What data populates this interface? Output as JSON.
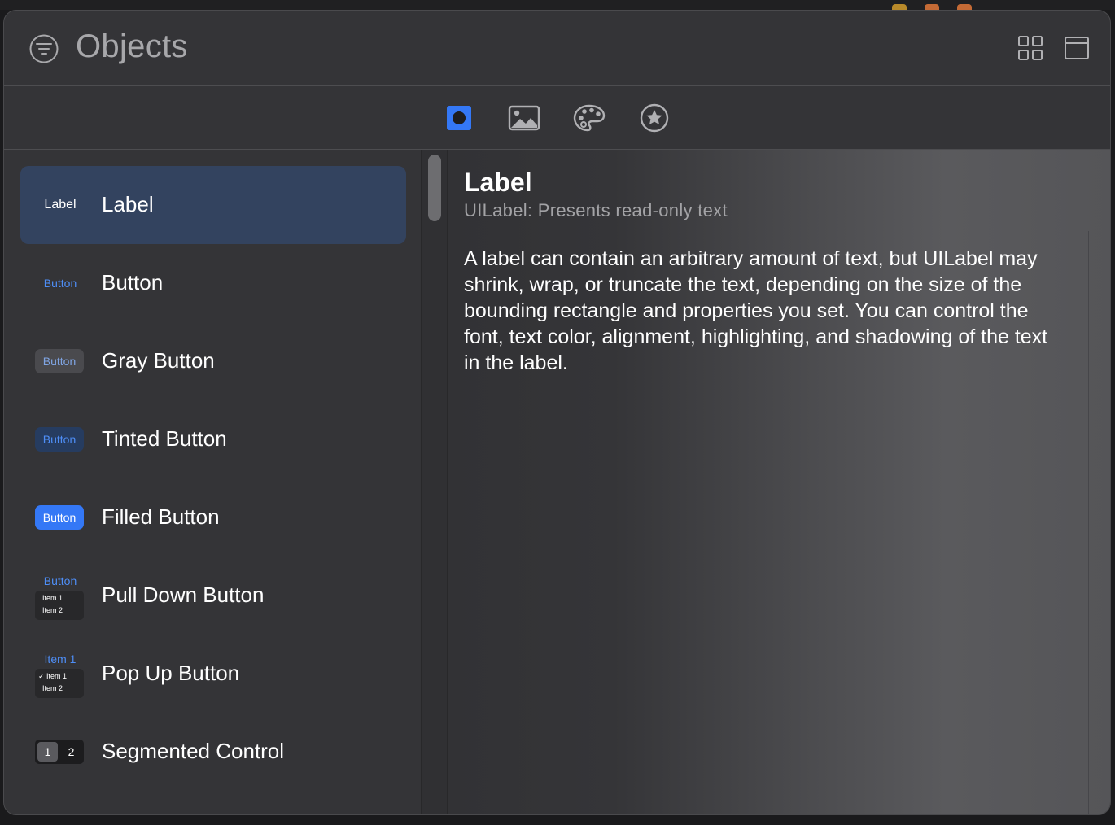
{
  "colors": {
    "accent": "#3478f6",
    "selected_row": "#33435f",
    "panel": "#343437",
    "icon_gray": "#b0b0b3",
    "tinted_button_text": "#4e8ef7"
  },
  "header": {
    "title": "Objects",
    "left_icon": "filter-icon",
    "right_icons": [
      "grid-view-icon",
      "list-view-icon"
    ]
  },
  "toolbar": {
    "tabs": [
      {
        "icon": "controls-icon",
        "selected": true
      },
      {
        "icon": "image-icon",
        "selected": false
      },
      {
        "icon": "color-palette-icon",
        "selected": false
      },
      {
        "icon": "star-icon",
        "selected": false
      }
    ]
  },
  "library": {
    "items": [
      {
        "label": "Label",
        "thumb": {
          "text": "Label"
        },
        "selected": true
      },
      {
        "label": "Button",
        "thumb": {
          "text": "Button"
        }
      },
      {
        "label": "Gray Button",
        "thumb": {
          "text": "Button"
        }
      },
      {
        "label": "Tinted Button",
        "thumb": {
          "text": "Button"
        }
      },
      {
        "label": "Filled Button",
        "thumb": {
          "text": "Button"
        }
      },
      {
        "label": "Pull Down Button",
        "thumb": {
          "text": "Button",
          "menu": [
            "Item 1",
            "Item 2"
          ]
        }
      },
      {
        "label": "Pop Up Button",
        "thumb": {
          "text": "Item 1",
          "menu": [
            "✓ Item 1",
            "Item 2"
          ]
        }
      },
      {
        "label": "Segmented Control",
        "thumb": {
          "segments": [
            "1",
            "2"
          ]
        }
      }
    ]
  },
  "detail": {
    "title": "Label",
    "subtitle": "UILabel: Presents read-only text",
    "description": "A label can contain an arbitrary amount of text, but UILabel may shrink, wrap, or truncate the text, depending on the size of the bounding rectangle and properties you set. You can control the font, text color, alignment, highlighting, and shadowing of the text in the label."
  }
}
